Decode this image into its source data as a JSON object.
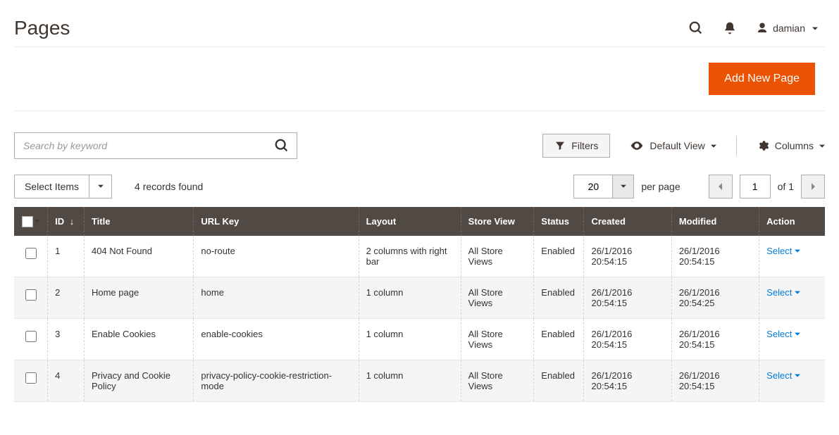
{
  "header": {
    "title": "Pages",
    "user": "damian"
  },
  "actions": {
    "add_new": "Add New Page"
  },
  "search": {
    "placeholder": "Search by keyword"
  },
  "toolbar": {
    "filters": "Filters",
    "default_view": "Default View",
    "columns": "Columns"
  },
  "list": {
    "select_items": "Select Items",
    "records_found": "4 records found",
    "page_size": "20",
    "per_page": "per page",
    "page_num": "1",
    "of_total": "of 1"
  },
  "table": {
    "headers": {
      "id": "ID",
      "title": "Title",
      "url_key": "URL Key",
      "layout": "Layout",
      "store_view": "Store View",
      "status": "Status",
      "created": "Created",
      "modified": "Modified",
      "action": "Action"
    },
    "action_label": "Select",
    "rows": [
      {
        "id": "1",
        "title": "404 Not Found",
        "url_key": "no-route",
        "layout": "2 columns with right bar",
        "store_view": "All Store Views",
        "status": "Enabled",
        "created": "26/1/2016 20:54:15",
        "modified": "26/1/2016 20:54:15"
      },
      {
        "id": "2",
        "title": "Home page",
        "url_key": "home",
        "layout": "1 column",
        "store_view": "All Store Views",
        "status": "Enabled",
        "created": "26/1/2016 20:54:15",
        "modified": "26/1/2016 20:54:25"
      },
      {
        "id": "3",
        "title": "Enable Cookies",
        "url_key": "enable-cookies",
        "layout": "1 column",
        "store_view": "All Store Views",
        "status": "Enabled",
        "created": "26/1/2016 20:54:15",
        "modified": "26/1/2016 20:54:15"
      },
      {
        "id": "4",
        "title": "Privacy and Cookie Policy",
        "url_key": "privacy-policy-cookie-restriction-mode",
        "layout": "1 column",
        "store_view": "All Store Views",
        "status": "Enabled",
        "created": "26/1/2016 20:54:15",
        "modified": "26/1/2016 20:54:15"
      }
    ]
  }
}
